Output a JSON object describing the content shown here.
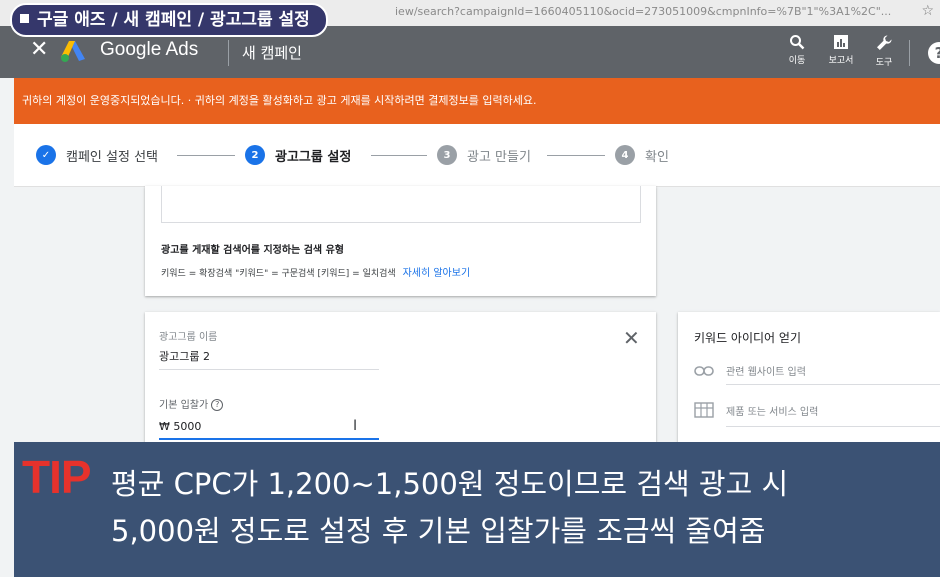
{
  "browser": {
    "url": "iew/search?campaignId=1660405110&ocid=273051009&cmpnInfo=%7B\"1\"%3A1%2C\"..."
  },
  "overlay": {
    "title": "구글 애즈 / 새 캠페인 / 광고그룹 설정"
  },
  "appbar": {
    "brand": "Google Ads",
    "page_name": "새 캠페인",
    "tools": [
      {
        "icon": "search-icon",
        "label": "이동"
      },
      {
        "icon": "bar-chart-icon",
        "label": "보고서"
      },
      {
        "icon": "wrench-icon",
        "label": "도구"
      }
    ],
    "help": "?"
  },
  "warning": {
    "text": "귀하의 계정이 운영중지되었습니다. · 귀하의 계정을 활성화하고 광고 게재를 시작하려면 결제정보를 입력하세요.",
    "color": "#e8611e"
  },
  "stepper": {
    "steps": [
      {
        "num": "✓",
        "label": "캠페인 설정 선택",
        "state": "done"
      },
      {
        "num": "2",
        "label": "광고그룹 설정",
        "state": "active"
      },
      {
        "num": "3",
        "label": "광고 만들기",
        "state": "pending"
      },
      {
        "num": "4",
        "label": "확인",
        "state": "pending"
      }
    ]
  },
  "match_types": {
    "heading": "광고를 게재할 검색어를 지정하는 검색 유형",
    "description": "키워드 = 확장검색 \"키워드\" = 구문검색 [키워드] = 일치검색",
    "learn_more": "자세히 알아보기"
  },
  "ad_group": {
    "name_label": "광고그룹 이름",
    "name_value": "광고그룹 2",
    "bid_label": "기본 입찰가",
    "bid_value": "₩ 5000"
  },
  "keyword_ideas": {
    "title": "키워드 아이디어 얻기",
    "website_placeholder": "관련 웹사이트 입력",
    "product_placeholder": "제품 또는 서비스 입력"
  },
  "tip": {
    "tag": "TIP",
    "line1": "평균 CPC가 1,200~1,500원 정도이므로 검색 광고 시",
    "line2": "5,000원 정도로 설정 후 기본 입찰가를 조금씩 줄여줌",
    "tag_color": "#e6322c"
  }
}
